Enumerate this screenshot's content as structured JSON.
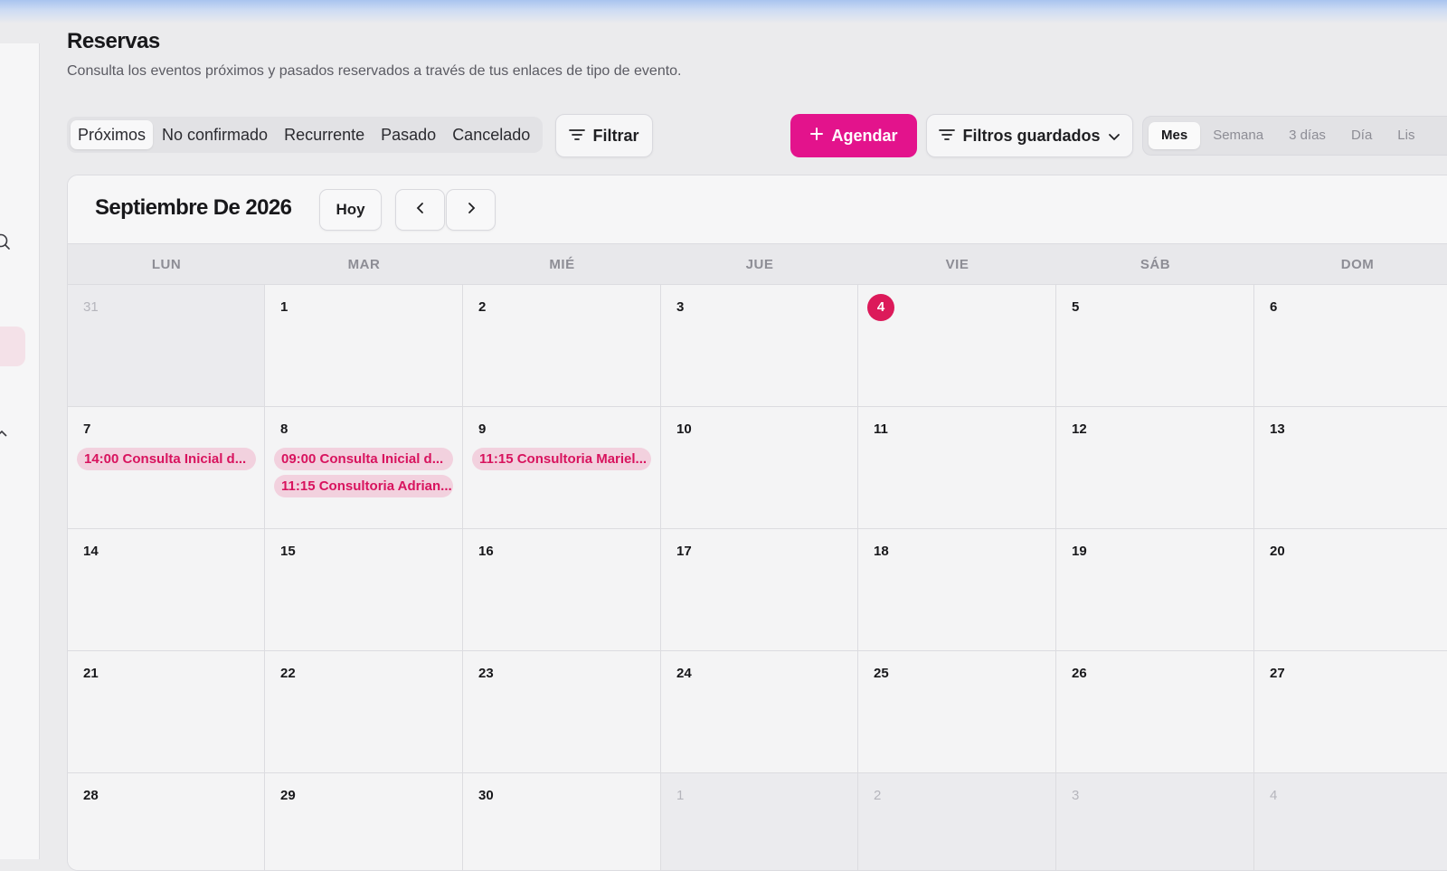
{
  "header": {
    "title": "Reservas",
    "subtitle": "Consulta los eventos próximos y pasados reservados a través de tus enlaces de tipo de evento."
  },
  "tabs": [
    {
      "label": "Próximos",
      "active": true
    },
    {
      "label": "No confirmado",
      "active": false
    },
    {
      "label": "Recurrente",
      "active": false
    },
    {
      "label": "Pasado",
      "active": false
    },
    {
      "label": "Cancelado",
      "active": false
    }
  ],
  "toolbar": {
    "filter_label": "Filtrar",
    "schedule_label": "Agendar",
    "saved_filters_label": "Filtros guardados"
  },
  "views": [
    {
      "label": "Mes",
      "active": true
    },
    {
      "label": "Semana",
      "active": false
    },
    {
      "label": "3 días",
      "active": false
    },
    {
      "label": "Día",
      "active": false
    },
    {
      "label": "Lis",
      "active": false
    }
  ],
  "calendar": {
    "month_title": "Septiembre De 2026",
    "today_label": "Hoy",
    "weekdays": [
      "LUN",
      "MAR",
      "MIÉ",
      "JUE",
      "VIE",
      "SÁB",
      "DOM"
    ],
    "weeks": [
      [
        {
          "day": "31",
          "outside": true
        },
        {
          "day": "1"
        },
        {
          "day": "2"
        },
        {
          "day": "3"
        },
        {
          "day": "4",
          "today": true
        },
        {
          "day": "5"
        },
        {
          "day": "6"
        }
      ],
      [
        {
          "day": "7",
          "events": [
            "14:00 Consulta Inicial d..."
          ]
        },
        {
          "day": "8",
          "events": [
            "09:00 Consulta Inicial d...",
            "11:15 Consultoria Adrian..."
          ]
        },
        {
          "day": "9",
          "events": [
            "11:15 Consultoria Mariel..."
          ]
        },
        {
          "day": "10"
        },
        {
          "day": "11"
        },
        {
          "day": "12"
        },
        {
          "day": "13"
        }
      ],
      [
        {
          "day": "14"
        },
        {
          "day": "15"
        },
        {
          "day": "16"
        },
        {
          "day": "17"
        },
        {
          "day": "18"
        },
        {
          "day": "19"
        },
        {
          "day": "20"
        }
      ],
      [
        {
          "day": "21"
        },
        {
          "day": "22"
        },
        {
          "day": "23"
        },
        {
          "day": "24"
        },
        {
          "day": "25"
        },
        {
          "day": "26"
        },
        {
          "day": "27"
        }
      ],
      [
        {
          "day": "28"
        },
        {
          "day": "29"
        },
        {
          "day": "30"
        },
        {
          "day": "1",
          "outside": true
        },
        {
          "day": "2",
          "outside": true
        },
        {
          "day": "3",
          "outside": true
        },
        {
          "day": "4",
          "outside": true
        }
      ]
    ]
  },
  "colors": {
    "accent": "#e3138c",
    "today": "#dc1a5a",
    "event_bg": "#f2d1de",
    "event_text": "#d8135e"
  }
}
